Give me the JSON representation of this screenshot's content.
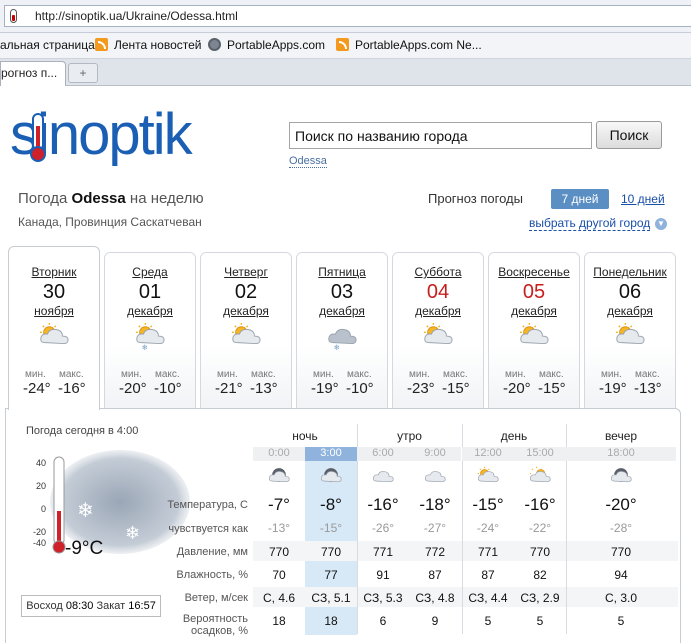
{
  "browser": {
    "url": "http://sinoptik.ua/Ukraine/Odessa.html",
    "bookmarks": [
      "альная страница",
      "Лента новостей",
      "PortableApps.com",
      "PortableApps.com Ne..."
    ],
    "tab_label": "рогноз п...",
    "new_tab": "+"
  },
  "site": {
    "logo": "sinoptik",
    "search_placeholder": "Поиск по названию города",
    "search_button": "Поиск",
    "search_hint": "Odessa"
  },
  "header": {
    "title_prefix": "Погода",
    "city": "Odessa",
    "title_suffix": "на неделю",
    "region": "Канада, Провинция Саскатчеван",
    "forecast_label": "Прогноз погоды",
    "tab_7": "7 дней",
    "tab_10": "10 дней",
    "choose_city": "выбрать другой город"
  },
  "days": [
    {
      "name": "Вторник",
      "date": "30",
      "month": "ноября",
      "min_label": "мин.",
      "max_label": "макс.",
      "min": "-24°",
      "max": "-16°",
      "red": false,
      "icon": "cloud-sun"
    },
    {
      "name": "Среда",
      "date": "01",
      "month": "декабря",
      "min_label": "мин.",
      "max_label": "макс.",
      "min": "-20°",
      "max": "-10°",
      "red": false,
      "icon": "cloud-sun-snow"
    },
    {
      "name": "Четверг",
      "date": "02",
      "month": "декабря",
      "min_label": "мин.",
      "max_label": "макс.",
      "min": "-21°",
      "max": "-13°",
      "red": false,
      "icon": "cloud-sun"
    },
    {
      "name": "Пятница",
      "date": "03",
      "month": "декабря",
      "min_label": "мин.",
      "max_label": "макс.",
      "min": "-19°",
      "max": "-10°",
      "red": false,
      "icon": "cloud-snow"
    },
    {
      "name": "Суббота",
      "date": "04",
      "month": "декабря",
      "min_label": "мин.",
      "max_label": "макс.",
      "min": "-23°",
      "max": "-15°",
      "red": true,
      "icon": "cloud-sun"
    },
    {
      "name": "Воскресенье",
      "date": "05",
      "month": "декабря",
      "min_label": "мин.",
      "max_label": "макс.",
      "min": "-20°",
      "max": "-15°",
      "red": true,
      "icon": "cloud-sun"
    },
    {
      "name": "Понедельник",
      "date": "06",
      "month": "декабря",
      "min_label": "мин.",
      "max_label": "макс.",
      "min": "-19°",
      "max": "-13°",
      "red": false,
      "icon": "cloud-sun"
    }
  ],
  "today": {
    "label": "Погода сегодня в 4:00",
    "temp": "-9°C",
    "scale": [
      "40",
      "20",
      "0",
      "-20",
      "-40"
    ],
    "sunrise_label": "Восход",
    "sunrise": "08:30",
    "sunset_label": "Закат",
    "sunset": "16:57"
  },
  "details": {
    "periods": [
      "ночь",
      "утро",
      "день",
      "вечер"
    ],
    "hours": [
      "0:00",
      "3:00",
      "6:00",
      "9:00",
      "12:00",
      "15:00",
      "18:00"
    ],
    "row_labels": [
      "Температура, С",
      "чувствуется как",
      "Давление, мм",
      "Влажность, %",
      "Ветер, м/сек",
      "Вероятность осадков, %"
    ],
    "temp": [
      "-7°",
      "-8°",
      "-16°",
      "-18°",
      "-15°",
      "-16°",
      "-20°"
    ],
    "feels": [
      "-13°",
      "-15°",
      "-26°",
      "-27°",
      "-24°",
      "-22°",
      "-28°"
    ],
    "pressure": [
      "770",
      "770",
      "771",
      "772",
      "771",
      "770",
      "770"
    ],
    "humidity": [
      "70",
      "77",
      "91",
      "87",
      "87",
      "82",
      "94"
    ],
    "wind": [
      "С, 4.6",
      "СЗ, 5.1",
      "СЗ, 5.3",
      "СЗ, 4.8",
      "СЗ, 4.4",
      "СЗ, 2.9",
      "С, 3.0"
    ],
    "precip": [
      "18",
      "18",
      "6",
      "9",
      "5",
      "5",
      "5"
    ],
    "icons": [
      "moon-cloud",
      "moon-cloud",
      "cloud",
      "cloud",
      "cloud-sun",
      "sun-cloud",
      "moon-cloud"
    ]
  },
  "colors": {
    "brand_blue": "#1a5fb4",
    "accent": "#5b8fc4",
    "red": "#c81d1d",
    "highlight": "#d7e8f7"
  }
}
